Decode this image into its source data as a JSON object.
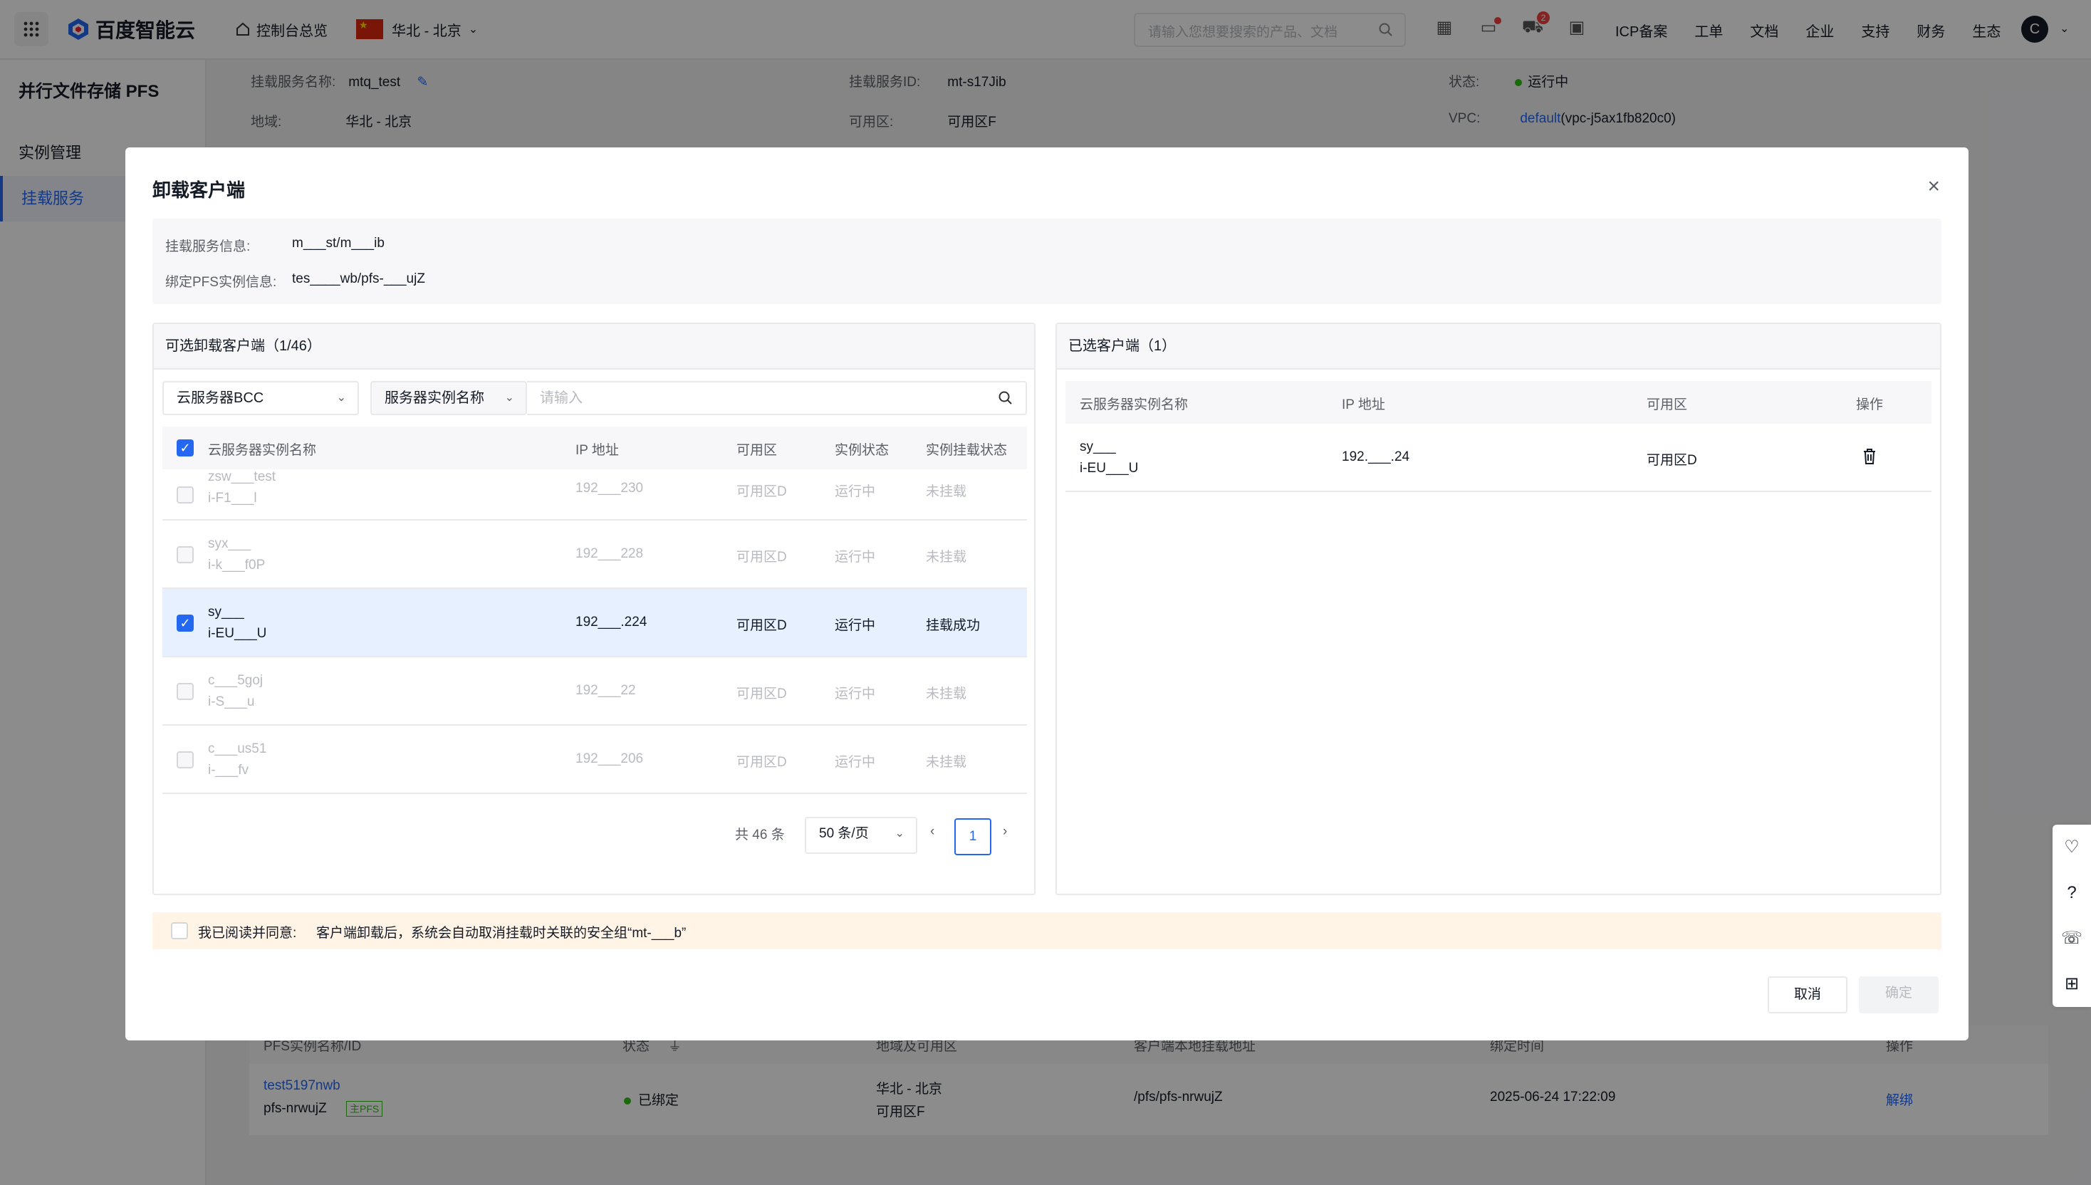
{
  "topbar": {
    "console_home": "控制台总览",
    "region": "华北 - 北京",
    "brand": "百度智能云",
    "search_placeholder": "请输入您想要搜索的产品、文档",
    "cart_badge": "2",
    "menu": [
      "ICP备案",
      "工单",
      "文档",
      "企业",
      "支持",
      "财务",
      "生态"
    ],
    "avatar": "C"
  },
  "sidebar": {
    "title": "并行文件存储 PFS",
    "items": [
      {
        "label": "实例管理",
        "active": false
      },
      {
        "label": "挂载服务",
        "active": true
      }
    ]
  },
  "background": {
    "mount_name_label": "挂载服务名称:",
    "mount_name_value": "mtq_test",
    "mount_id_label": "挂载服务ID:",
    "mount_id_value": "mt-s17Jib",
    "status_label": "状态:",
    "status_value": "运行中",
    "region_label": "地域:",
    "region_value": "华北 - 北京",
    "zone_label": "可用区:",
    "zone_value": "可用区F",
    "vpc_label": "VPC:",
    "vpc_link": "default",
    "vpc_id": "(vpc-j5ax1fb820c0)",
    "table_headers": [
      "PFS实例名称/ID",
      "状态",
      "地域及可用区",
      "客户端本地挂载地址",
      "绑定时间",
      "操作"
    ],
    "table_row": {
      "name": "test5197nwb",
      "id": "pfs-nrwujZ",
      "tag": "主PFS",
      "status": "已绑定",
      "region": "华北 - 北京",
      "zone": "可用区F",
      "mount_path": "/pfs/pfs-nrwujZ",
      "bind_time": "2025-06-24 17:22:09",
      "action": "解绑"
    }
  },
  "modal": {
    "title": "卸载客户端",
    "info": [
      {
        "label": "挂载服务信息:",
        "value": "m___st/m___ib"
      },
      {
        "label": "绑定PFS实例信息:",
        "value": "tes____wb/pfs-___ujZ"
      }
    ],
    "left_panel": {
      "title": "可选卸载客户端（1/46）",
      "type_select": "云服务器BCC",
      "field_select": "服务器实例名称",
      "search_placeholder": "请输入",
      "headers": [
        "云服务器实例名称",
        "IP 地址",
        "可用区",
        "实例状态",
        "实例挂载状态"
      ],
      "rows": [
        {
          "name": "zsw___test",
          "id": "i-F1___l",
          "ip": "192___230",
          "zone": "可用区D",
          "state": "运行中",
          "mount": "未挂载",
          "checked": false,
          "dim": true
        },
        {
          "name": "syx___",
          "id": "i-k___f0P",
          "ip": "192___228",
          "zone": "可用区D",
          "state": "运行中",
          "mount": "未挂载",
          "checked": false,
          "dim": true
        },
        {
          "name": "sy___",
          "id": "i-EU___U",
          "ip": "192___.224",
          "zone": "可用区D",
          "state": "运行中",
          "mount": "挂载成功",
          "checked": true,
          "dim": false
        },
        {
          "name": "c___5goj",
          "id": "i-S___u",
          "ip": "192___22",
          "zone": "可用区D",
          "state": "运行中",
          "mount": "未挂载",
          "checked": false,
          "dim": true
        },
        {
          "name": "c___us51",
          "id": "i-___fv",
          "ip": "192___206",
          "zone": "可用区D",
          "state": "运行中",
          "mount": "未挂载",
          "checked": false,
          "dim": true
        }
      ],
      "total": "共 46 条",
      "page_size": "50 条/页",
      "page": "1"
    },
    "right_panel": {
      "title": "已选客户端（1）",
      "headers": [
        "云服务器实例名称",
        "IP 地址",
        "可用区",
        "操作"
      ],
      "rows": [
        {
          "name": "sy___",
          "id": "i-EU___U",
          "ip": "192.___.24",
          "zone": "可用区D"
        }
      ]
    },
    "agreement": {
      "label": "我已阅读并同意:",
      "text": "客户端卸载后，系统会自动取消挂载时关联的安全组“mt-___b”"
    },
    "cancel": "取消",
    "confirm": "确定"
  },
  "colors": {
    "primary": "#2468f2",
    "running": "#30bf13",
    "selected_row": "#e6f0ff",
    "warning_bg": "#fff4e6"
  }
}
